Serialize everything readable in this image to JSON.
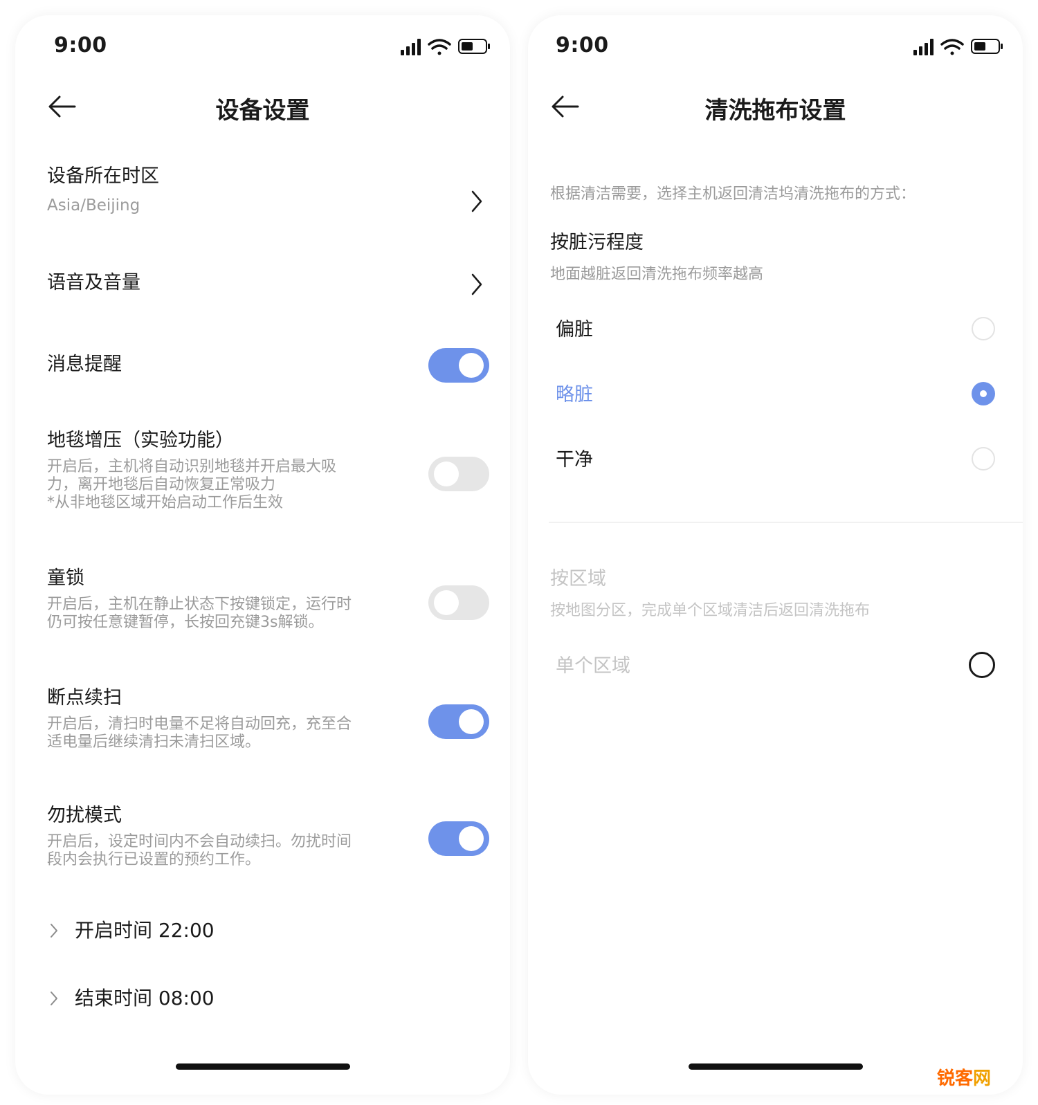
{
  "colors": {
    "accent": "#6e92ea",
    "toggle_off": "#e6e6e6",
    "muted_text": "#9b9b9b",
    "disabled_text": "#c4c4c4"
  },
  "left": {
    "status": {
      "time": "9:00"
    },
    "nav": {
      "title": "设备设置"
    },
    "timezone": {
      "title": "设备所在时区",
      "value": "Asia/Beijing"
    },
    "voice": {
      "title": "语音及音量"
    },
    "notify": {
      "title": "消息提醒",
      "on": true
    },
    "carpet": {
      "title": "地毯增压（实验功能）",
      "desc1": "开启后，主机将自动识别地毯并开启最大吸",
      "desc2": "力，离开地毯后自动恢复正常吸力",
      "desc3": "*从非地毯区域开始启动工作后生效",
      "on": false
    },
    "childlock": {
      "title": "童锁",
      "desc1": "开启后，主机在静止状态下按键锁定，运行时",
      "desc2": "仍可按任意键暂停，长按回充键3s解锁。",
      "on": false
    },
    "resume": {
      "title": "断点续扫",
      "desc1": "开启后，清扫时电量不足将自动回充，充至合",
      "desc2": "适电量后继续清扫未清扫区域。",
      "on": true
    },
    "dnd": {
      "title": "勿扰模式",
      "desc1": "开启后，设定时间内不会自动续扫。勿扰时间",
      "desc2": "段内会执行已设置的预约工作。",
      "on": true
    },
    "dnd_start": {
      "label": "开启时间 22:00"
    },
    "dnd_end": {
      "label": "结束时间 08:00"
    }
  },
  "right": {
    "status": {
      "time": "9:00"
    },
    "nav": {
      "title": "清洗拖布设置"
    },
    "intro": "根据清洁需要，选择主机返回清洁坞清洗拖布的方式：",
    "by_dirt": {
      "title": "按脏污程度",
      "desc": "地面越脏返回清洗拖布频率越高",
      "options": [
        {
          "label": "偏脏",
          "selected": false
        },
        {
          "label": "略脏",
          "selected": true
        },
        {
          "label": "干净",
          "selected": false
        }
      ]
    },
    "by_area": {
      "title": "按区域",
      "desc": "按地图分区，完成单个区域清洁后返回清洗拖布",
      "options": [
        {
          "label": "单个区域",
          "selected": false
        }
      ]
    }
  },
  "watermark": {
    "part1": "锐客",
    "part2": "网"
  }
}
